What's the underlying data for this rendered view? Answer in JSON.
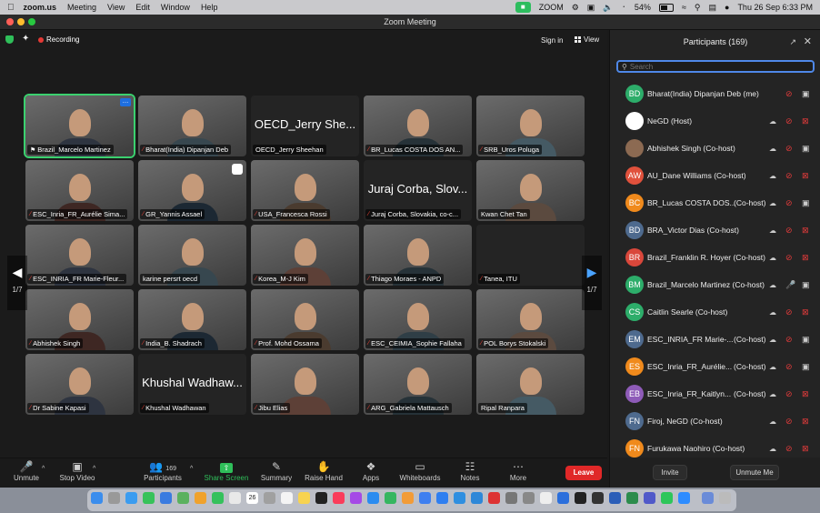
{
  "menubar": {
    "app": "zoom.us",
    "menus": [
      "Meeting",
      "View",
      "Edit",
      "Window",
      "Help"
    ],
    "zoom_label": "ZOOM",
    "battery": "54%",
    "datetime": "Thu 26 Sep  6:33 PM"
  },
  "window": {
    "title": "Zoom Meeting"
  },
  "topbar": {
    "recording": "Recording",
    "signin": "Sign in",
    "view": "View"
  },
  "nav": {
    "left_page": "1/7",
    "right_page": "1/7"
  },
  "tiles": [
    {
      "name": "Brazil_Marcelo Martinez",
      "video": true,
      "active": true,
      "mic_muted": false,
      "pinned": true
    },
    {
      "name": "Bharat(India) Dipanjan Deb",
      "video": true,
      "mic_muted": true
    },
    {
      "name": "OECD_Jerry Sheehan",
      "big": "OECD_Jerry She...",
      "video": false,
      "mic_muted": false
    },
    {
      "name": "BR_Lucas COSTA DOS AN...",
      "video": true,
      "mic_muted": true
    },
    {
      "name": "SRB_Uros Poluga",
      "video": true,
      "mic_muted": true
    },
    {
      "name": "ESC_Inria_FR_Aurélie Sima...",
      "video": true,
      "mic_muted": true
    },
    {
      "name": "GR_Yannis Assael",
      "video": true,
      "mic_muted": true
    },
    {
      "name": "USA_Francesca Rossi",
      "video": true,
      "mic_muted": true
    },
    {
      "name": "Juraj Corba, Slovakia, co-c...",
      "big": "Juraj Corba, Slov...",
      "video": false,
      "mic_muted": true
    },
    {
      "name": "Kwan Chet Tan",
      "video": true,
      "mic_muted": false
    },
    {
      "name": "ESC_INRIA_FR Marie-Fleur...",
      "video": true,
      "mic_muted": true
    },
    {
      "name": "karine persrt oecd",
      "video": true,
      "mic_muted": false
    },
    {
      "name": "Korea_M-J Kim",
      "video": true,
      "mic_muted": true
    },
    {
      "name": "Thiago Moraes - ANPD",
      "video": true,
      "mic_muted": true
    },
    {
      "name": "Tanea, ITU",
      "video": false,
      "mic_muted": true
    },
    {
      "name": "Abhishek Singh",
      "video": true,
      "mic_muted": true
    },
    {
      "name": "India_B. Shadrach",
      "video": true,
      "mic_muted": true
    },
    {
      "name": "Prof. Mohd Ossama",
      "video": true,
      "mic_muted": true
    },
    {
      "name": "ESC_CEIMIA_Sophie Fallaha",
      "video": true,
      "mic_muted": true
    },
    {
      "name": "POL Borys Stokalski",
      "video": true,
      "mic_muted": true
    },
    {
      "name": "Dr Sabine Kapasi",
      "video": true,
      "mic_muted": true
    },
    {
      "name": "Khushal Wadhawan",
      "big": "Khushal Wadhaw...",
      "video": false,
      "mic_muted": true
    },
    {
      "name": "Jibu Elias",
      "video": true,
      "mic_muted": true
    },
    {
      "name": "ARG_Gabriela Mattausch",
      "video": true,
      "mic_muted": true
    },
    {
      "name": "Ripal Ranpara",
      "video": true,
      "mic_muted": false
    }
  ],
  "toolbar": {
    "unmute": "Unmute",
    "stop_video": "Stop Video",
    "participants": "Participants",
    "participants_count": "169",
    "share_screen": "Share Screen",
    "summary": "Summary",
    "raise_hand": "Raise Hand",
    "apps": "Apps",
    "whiteboards": "Whiteboards",
    "notes": "Notes",
    "more": "More",
    "leave": "Leave"
  },
  "panel": {
    "title": "Participants (169)",
    "search_placeholder": "Search",
    "invite": "Invite",
    "unmute_me": "Unmute Me",
    "participants": [
      {
        "initials": "BD",
        "name": "Bharat(India) Dipanjan Deb (me)",
        "role": "",
        "color": "#2dad6a",
        "cam": "off-gray"
      },
      {
        "initials": "",
        "name": "NeGD (Host)",
        "role": "",
        "color": "#ffffff",
        "cam": "off"
      },
      {
        "initials": "",
        "name": "Abhishek Singh (Co-host)",
        "role": "",
        "color": "#8c6a52",
        "cam": "on"
      },
      {
        "initials": "AW",
        "name": "AU_Dane Williams (Co-host)",
        "role": "",
        "color": "#e0513c",
        "cam": "off"
      },
      {
        "initials": "BC",
        "name": "BR_Lucas COSTA DOS...",
        "role": "(Co-host)",
        "color": "#f08a1c",
        "cam": "on"
      },
      {
        "initials": "BD",
        "name": "BRA_Victor Dias (Co-host)",
        "role": "",
        "color": "#4e6a8e",
        "cam": "off"
      },
      {
        "initials": "BR",
        "name": "Brazil_Franklin R. Hoyer (Co-host)",
        "role": "",
        "color": "#d9473b",
        "cam": "off"
      },
      {
        "initials": "BM",
        "name": "Brazil_Marcelo Martinez (Co-host)",
        "role": "",
        "color": "#2dad6a",
        "cam": "on",
        "mic_on": true
      },
      {
        "initials": "CS",
        "name": "Caitlin Searle (Co-host)",
        "role": "",
        "color": "#2dad6a",
        "cam": "off"
      },
      {
        "initials": "EM",
        "name": "ESC_INRIA_FR Marie-...",
        "role": "(Co-host)",
        "color": "#4e6a8e",
        "cam": "on"
      },
      {
        "initials": "ES",
        "name": "ESC_Inria_FR_Aurélie...",
        "role": "(Co-host)",
        "color": "#f08a1c",
        "cam": "on"
      },
      {
        "initials": "EB",
        "name": "ESC_Inria_FR_Kaitlyn...",
        "role": "(Co-host)",
        "color": "#8e5bb8",
        "cam": "off"
      },
      {
        "initials": "FN",
        "name": "Firoj, NeGD (Co-host)",
        "role": "",
        "color": "#4e6a8e",
        "cam": "off"
      },
      {
        "initials": "FN",
        "name": "Furukawa Naohiro (Co-host)",
        "role": "",
        "color": "#f08a1c",
        "cam": "off"
      }
    ]
  },
  "dock": {
    "calendar_day": "26"
  }
}
